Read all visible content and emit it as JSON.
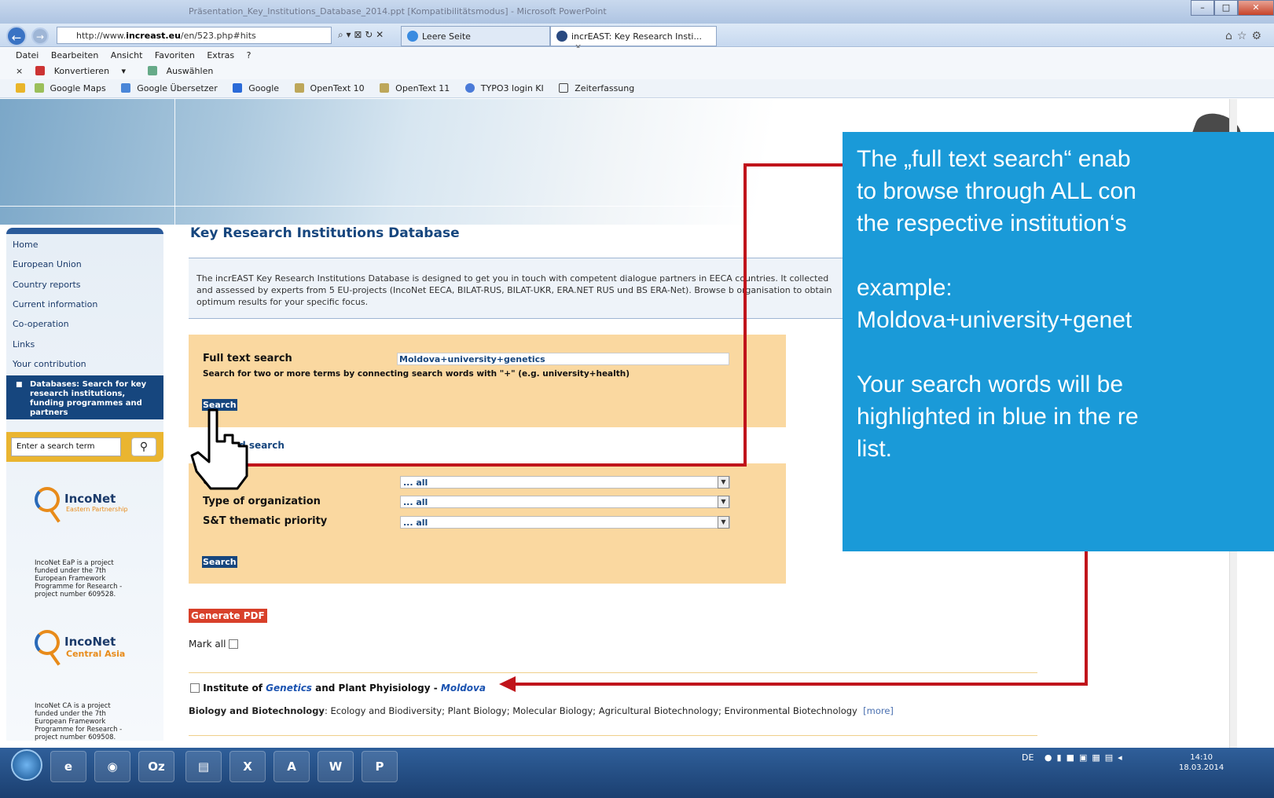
{
  "browser": {
    "title_text": "Präsentation_Key_Institutions_Database_2014.ppt [Kompatibilitätsmodus] - Microsoft PowerPoint",
    "address_prefix": "http://www.",
    "address_domain": "increast.eu",
    "address_path": "/en/523.php#hits",
    "addr_controls": "⌕ ▾ ⊠ ↻ ✕",
    "tabs": [
      {
        "label": "Leere Seite"
      },
      {
        "label": "incrEAST: Key Research Insti...",
        "close": "×"
      }
    ],
    "menu": [
      "Datei",
      "Bearbeiten",
      "Ansicht",
      "Favoriten",
      "Extras",
      "?"
    ],
    "cmd": {
      "close": "×",
      "convert": "Konvertieren",
      "convert_arrow": "▾",
      "select": "Auswählen"
    },
    "favorites": [
      "Google Maps",
      "Google Übersetzer",
      "Google",
      "OpenText 10",
      "OpenText 11",
      "TYPO3 login KI",
      "Zeiterfassung"
    ],
    "window_buttons": [
      "–",
      "□",
      "✕"
    ]
  },
  "sidebar": {
    "items": [
      "Home",
      "European Union",
      "Country reports",
      "Current information",
      "Co-operation",
      "Links",
      "Your contribution"
    ],
    "active_item": "Databases: Search for key research institutions, funding programmes and partners",
    "search_placeholder": "Enter a search term",
    "logos": [
      {
        "name": "IncoNet",
        "sub": "Eastern Partnership",
        "note": "IncoNet EaP is a project funded under the 7th European Framework Programme for Research - project number 609528."
      },
      {
        "name": "IncoNet",
        "sub": "Central Asia",
        "note": "IncoNet CA is a project funded under the 7th European Framework Programme for Research - project number 609508."
      }
    ]
  },
  "main": {
    "title": "Key Research Institutions Database",
    "intro": "The incrEAST Key Research Institutions Database is designed to get you in touch with competent dialogue partners in EECA countries. It collected and assessed by experts from 5 EU-projects (IncoNet EECA, BILAT-RUS, BILAT-UKR, ERA.NET RUS und BS ERA-Net). Browse b organisation to obtain optimum results for your specific focus.",
    "fulltext_label": "Full text search",
    "fulltext_value": "Moldova+university+genetics",
    "fulltext_hint": "Search for two or more terms by connecting search words with \"+\" (e.g. university+health)",
    "search_btn": "Search",
    "advanced_link": "ed search",
    "filters": [
      {
        "label": "C",
        "value": "... all"
      },
      {
        "label": "Type of organization",
        "value": "... all"
      },
      {
        "label": "S&T thematic priority",
        "value": "... all"
      }
    ],
    "search_btn2": "Search",
    "pdf_btn": "Generate PDF",
    "mark_all": "Mark all",
    "result": {
      "pre": "Institute of ",
      "hl1": "Genetics",
      "mid": " and Plant Phyisiology - ",
      "hl2": "Moldova",
      "field": "Biology and Biotechnology",
      "desc": ": Ecology and Biodiversity; Plant Biology; Molecular Biology; Agricultural Biotechnology; Environmental Biotechnology",
      "more": "[more]"
    }
  },
  "callout": {
    "text": "The „full text search“ enab\nto browse through ALL con\nthe respective institution‘s\n\nexample:\nMoldova+university+genet\n\nYour search words will be\nhighlighted in blue in the re\nlist."
  },
  "taskbar": {
    "apps": [
      "e",
      "◉",
      "Oz",
      "▤",
      "X",
      "A",
      "W",
      "P"
    ],
    "lang": "DE",
    "time": "14:10",
    "date": "18.03.2014"
  },
  "colors": {
    "accent": "#16467e",
    "callout": "#1a9ad8",
    "arrow": "#c0141b",
    "searchbox": "#fad8a0"
  }
}
